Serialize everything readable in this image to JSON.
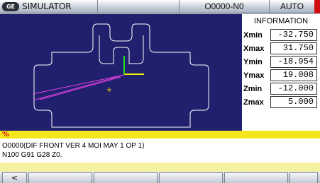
{
  "titlebar": {
    "logo_text": "GE",
    "app_title": "SIMULATOR",
    "program_number": "O0000-N0",
    "mode": "AUTO"
  },
  "info_panel": {
    "title": "INFORMATION",
    "rows": [
      {
        "label": "Xmin",
        "value": "-32.750"
      },
      {
        "label": "Xmax",
        "value": "31.750"
      },
      {
        "label": "Ymin",
        "value": "-18.954"
      },
      {
        "label": "Ymax",
        "value": "19.008"
      },
      {
        "label": "Zmin",
        "value": "-12.000"
      },
      {
        "label": "Zmax",
        "value": "5.000"
      }
    ]
  },
  "program": {
    "percent_marker": "%",
    "line1": "O0000(DIF FRONT VER 4 MOI MAY 1 OP 1)",
    "line2": "N100 G91 G28 Z0."
  },
  "softkeys": {
    "back_label": "<"
  },
  "colors": {
    "viewport_bg": "#20206e",
    "part_outline": "#ffffff",
    "axis_x": "#f0f000",
    "axis_y": "#20e020",
    "toolpath": "#e040e0",
    "status_bar": "#f4e61a"
  }
}
